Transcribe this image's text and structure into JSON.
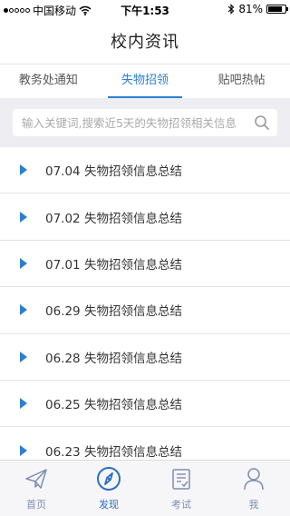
{
  "status_bar": {
    "carrier": "中国移动",
    "time": "下午1:53",
    "battery": "81%",
    "battery_level": 0.81,
    "signal_bars": 1,
    "icons": [
      "wifi-icon",
      "bluetooth-icon",
      "battery-icon"
    ]
  },
  "nav": {
    "title": "校内资讯"
  },
  "tabs": [
    {
      "label": "教务处通知",
      "active": false
    },
    {
      "label": "失物招领",
      "active": true
    },
    {
      "label": "贴吧热帖",
      "active": false
    }
  ],
  "search": {
    "placeholder": "输入关键词,搜索近5天的失物招领相关信息",
    "value": "",
    "icon": "search-icon"
  },
  "list": [
    {
      "date": "07.04",
      "title": "失物招领信息总结"
    },
    {
      "date": "07.02",
      "title": "失物招领信息总结"
    },
    {
      "date": "07.01",
      "title": "失物招领信息总结"
    },
    {
      "date": "06.29",
      "title": "失物招领信息总结"
    },
    {
      "date": "06.28",
      "title": "失物招领信息总结"
    },
    {
      "date": "06.25",
      "title": "失物招领信息总结"
    },
    {
      "date": "06.23",
      "title": "失物招领信息总结"
    }
  ],
  "tabbar": [
    {
      "label": "首页",
      "icon": "paper-plane-icon",
      "active": false
    },
    {
      "label": "发现",
      "icon": "compass-icon",
      "active": true
    },
    {
      "label": "考试",
      "icon": "exam-checklist-icon",
      "active": false
    },
    {
      "label": "我",
      "icon": "person-icon",
      "active": false
    }
  ],
  "colors": {
    "accent": "#2a7fd4",
    "tabbar_inactive": "#7a8fb0",
    "search_bg": "#eeeef2"
  }
}
